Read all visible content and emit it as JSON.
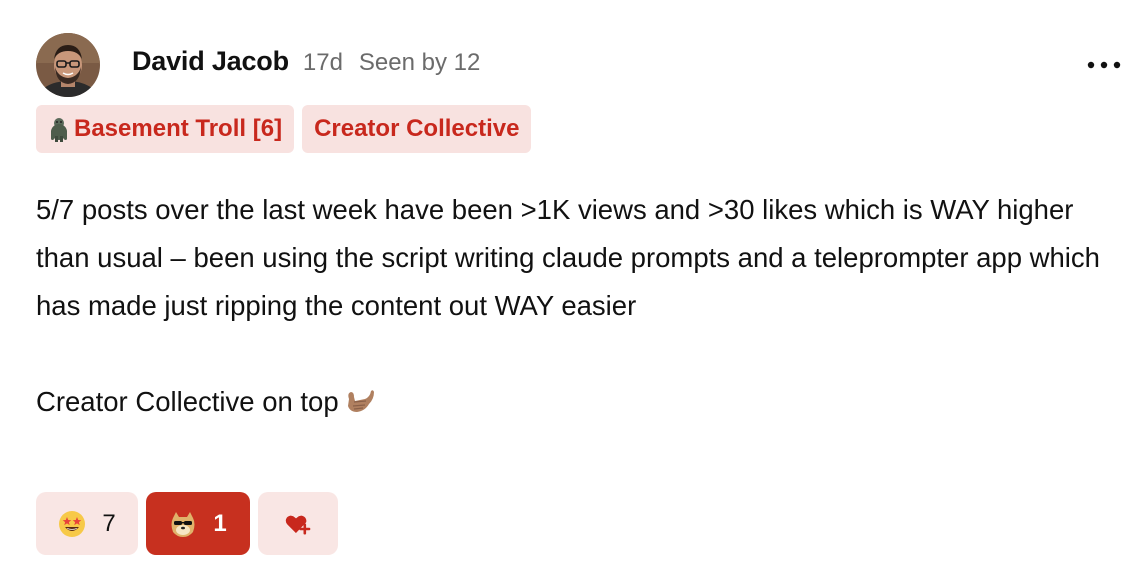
{
  "post": {
    "author": "David Jacob",
    "age": "17d",
    "seen": "Seen by 12",
    "tags": [
      {
        "label": "Basement Troll [6]",
        "icon": "troll-icon"
      },
      {
        "label": "Creator Collective"
      }
    ],
    "body": {
      "paragraph1": "5/7 posts over the last week have been >1K views and >30 likes which is WAY higher than usual – been using the script writing claude prompts and a teleprompter app which has made just ripping the content out WAY easier",
      "paragraph2": "Creator Collective on top"
    },
    "reactions": [
      {
        "emoji": "star-struck-emoji-icon",
        "count": "7"
      },
      {
        "emoji": "doge-sunglasses-emoji-icon",
        "count": "1",
        "active": true
      },
      {
        "emoji": "add-reaction-icon"
      }
    ]
  },
  "colors": {
    "accent": "#c8281d",
    "tag_bg": "#f8e2e0",
    "reaction_bg": "#f9e6e4",
    "reaction_active_bg": "#c7301f",
    "muted_text": "#6b6b6b"
  }
}
